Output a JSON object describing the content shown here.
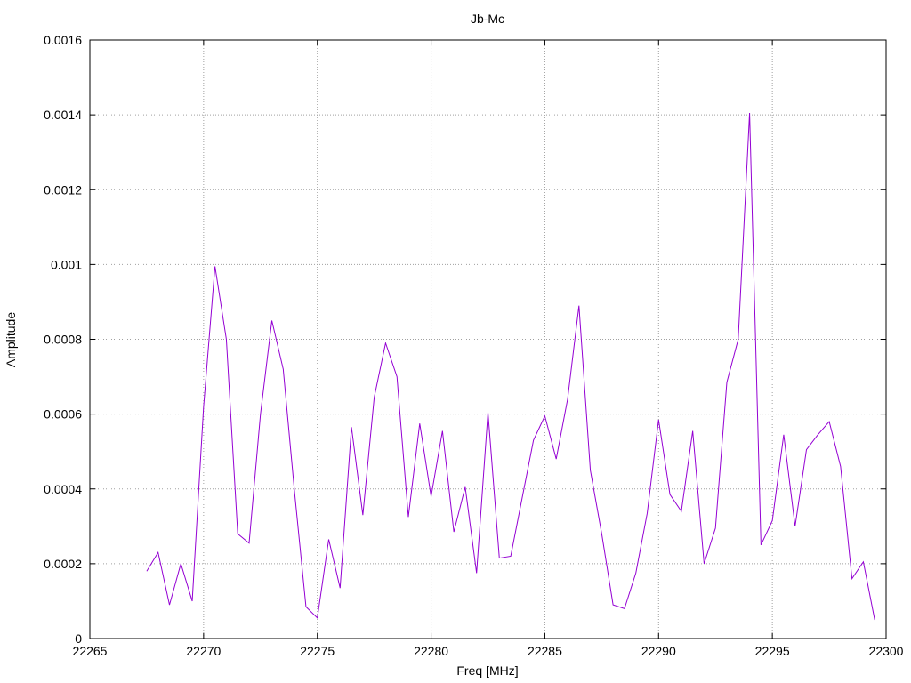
{
  "chart_data": {
    "type": "line",
    "title": "Jb-Mc",
    "xlabel": "Freq [MHz]",
    "ylabel": "Amplitude",
    "xlim": [
      22265,
      22300
    ],
    "ylim": [
      0,
      0.0016
    ],
    "xticks": [
      "22265",
      "22270",
      "22275",
      "22280",
      "22285",
      "22290",
      "22295",
      "22300"
    ],
    "yticks": [
      "0",
      "0.0002",
      "0.0004",
      "0.0006",
      "0.0008",
      "0.001",
      "0.0012",
      "0.0014",
      "0.0016"
    ],
    "grid": true,
    "line_color": "#9400d3",
    "series": [
      {
        "x": [
          22267.5,
          22268,
          22268.5,
          22269,
          22269.5,
          22270,
          22270.5,
          22271,
          22271.5,
          22272,
          22272.5,
          22273,
          22273.5,
          22274,
          22274.5,
          22275,
          22275.5,
          22276,
          22276.5,
          22277,
          22277.5,
          22278,
          22278.5,
          22279,
          22279.5,
          22280,
          22280.5,
          22281,
          22281.5,
          22282,
          22282.5,
          22283,
          22283.5,
          22284,
          22284.5,
          22285,
          22285.5,
          22286,
          22286.5,
          22287,
          22287.5,
          22288,
          22288.5,
          22289,
          22289.5,
          22290,
          22290.5,
          22291,
          22291.5,
          22292,
          22292.5,
          22293,
          22293.5,
          22294,
          22294.5,
          22295,
          22295.5,
          22296,
          22296.5,
          22297,
          22297.5,
          22298,
          22298.5,
          22299,
          22299.5
        ],
        "y": [
          0.00018,
          0.00023,
          9e-05,
          0.0002,
          0.0001,
          0.00062,
          0.000995,
          0.0008,
          0.00028,
          0.000255,
          0.0006,
          0.00085,
          0.00072,
          0.00039,
          8.5e-05,
          5.5e-05,
          0.000265,
          0.000135,
          0.000565,
          0.00033,
          0.000645,
          0.00079,
          0.0007,
          0.000325,
          0.000575,
          0.00038,
          0.000555,
          0.000285,
          0.000405,
          0.000175,
          0.000605,
          0.000215,
          0.00022,
          0.000375,
          0.00053,
          0.000595,
          0.00048,
          0.00064,
          0.00089,
          0.00045,
          0.00028,
          9e-05,
          8e-05,
          0.000175,
          0.000335,
          0.000585,
          0.000385,
          0.00034,
          0.000555,
          0.0002,
          0.000295,
          0.000685,
          0.0008,
          0.001405,
          0.00025,
          0.000315,
          0.000545,
          0.0003,
          0.000505,
          0.000545,
          0.00058,
          0.00046,
          0.00016,
          0.000205,
          5e-05
        ]
      }
    ]
  }
}
